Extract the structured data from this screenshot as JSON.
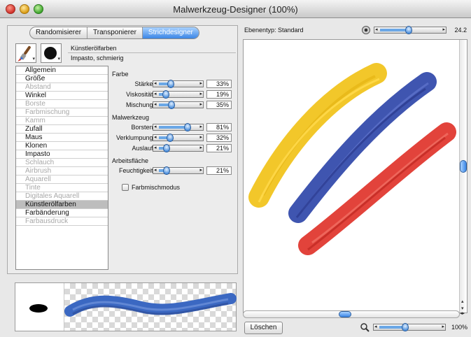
{
  "window": {
    "title": "Malwerkzeug-Designer (100%)"
  },
  "tabs": [
    {
      "label": "Randomisierer",
      "active": false
    },
    {
      "label": "Transponierer",
      "active": false
    },
    {
      "label": "Strichdesigner",
      "active": true
    }
  ],
  "brush": {
    "category": "Künstlerölfarben",
    "variant": "Impasto, schmierig",
    "icons": [
      "paintbrush-icon",
      "black-dab-icon"
    ]
  },
  "categories": [
    {
      "label": "Allgemein",
      "enabled": true,
      "selected": false
    },
    {
      "label": "Größe",
      "enabled": true,
      "selected": false
    },
    {
      "label": "Abstand",
      "enabled": false,
      "selected": false
    },
    {
      "label": "Winkel",
      "enabled": true,
      "selected": false
    },
    {
      "label": "Borste",
      "enabled": false,
      "selected": false
    },
    {
      "label": "Farbmischung",
      "enabled": false,
      "selected": false
    },
    {
      "label": "Kamm",
      "enabled": false,
      "selected": false
    },
    {
      "label": "Zufall",
      "enabled": true,
      "selected": false
    },
    {
      "label": "Maus",
      "enabled": true,
      "selected": false
    },
    {
      "label": "Klonen",
      "enabled": true,
      "selected": false
    },
    {
      "label": "Impasto",
      "enabled": true,
      "selected": false
    },
    {
      "label": "Schlauch",
      "enabled": false,
      "selected": false
    },
    {
      "label": "Airbrush",
      "enabled": false,
      "selected": false
    },
    {
      "label": "Aquarell",
      "enabled": false,
      "selected": false
    },
    {
      "label": "Tinte",
      "enabled": false,
      "selected": false
    },
    {
      "label": "Digitales Aquarell",
      "enabled": false,
      "selected": false
    },
    {
      "label": "Künstlerölfarben",
      "enabled": true,
      "selected": true
    },
    {
      "label": "Farbänderung",
      "enabled": true,
      "selected": false
    },
    {
      "label": "Farbausdruck",
      "enabled": false,
      "selected": false
    }
  ],
  "settings": {
    "farbe": {
      "heading": "Farbe",
      "staerke": {
        "label": "Stärke:",
        "value": "33%",
        "fraction": 0.33
      },
      "viskositaet": {
        "label": "Viskosität:",
        "value": "19%",
        "fraction": 0.19
      },
      "mischung": {
        "label": "Mischung:",
        "value": "35%",
        "fraction": 0.35
      }
    },
    "malwerkzeug": {
      "heading": "Malwerkzeug",
      "borsten": {
        "label": "Borsten:",
        "value": "81%",
        "fraction": 0.81
      },
      "verklumpung": {
        "label": "Verklumpung:",
        "value": "32%",
        "fraction": 0.32
      },
      "auslauf": {
        "label": "Auslauf:",
        "value": "21%",
        "fraction": 0.21
      }
    },
    "arbeitsflaeche": {
      "heading": "Arbeitsfläche",
      "feuchtigkeit": {
        "label": "Feuchtigkeit:",
        "value": "21%",
        "fraction": 0.21
      }
    },
    "farbmischmodus": {
      "label": "Farbmischmodus",
      "checked": false
    }
  },
  "layer": {
    "label": "Ebenentyp: Standard",
    "value": "24.2",
    "fraction": 0.5
  },
  "canvas": {
    "strokes": [
      {
        "name": "yellow-stroke",
        "color": "#f2c72a"
      },
      {
        "name": "blue-stroke",
        "color": "#3f55b0"
      },
      {
        "name": "red-stroke",
        "color": "#e2433b"
      }
    ]
  },
  "footer": {
    "clear_label": "Löschen",
    "zoom_value": "100%",
    "zoom_fraction": 0.45
  },
  "colors": {
    "accent": "#3b86e6",
    "selected_row": "#bdbdbd"
  }
}
